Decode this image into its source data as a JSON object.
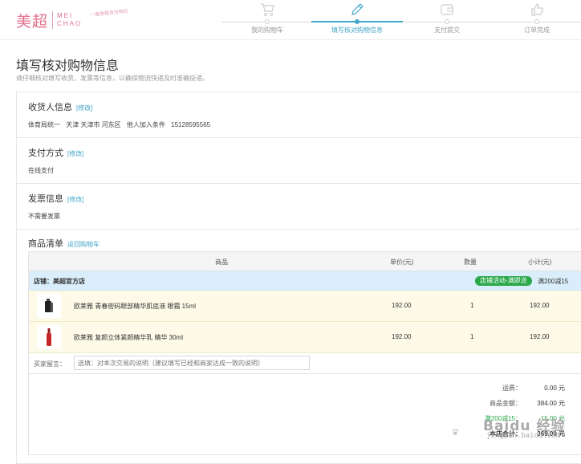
{
  "logo": {
    "cn": "美超",
    "en1": "MEI",
    "en2": "CHAO",
    "slogan": "一直做我身份陶社"
  },
  "steps": [
    {
      "label": "我的购物车",
      "icon": "cart-icon"
    },
    {
      "label": "填写核对购物信息",
      "icon": "pencil-icon",
      "active": true
    },
    {
      "label": "支付提交",
      "icon": "wallet-icon"
    },
    {
      "label": "订单完成",
      "icon": "thumbs-up-icon"
    }
  ],
  "page": {
    "title": "填写核对购物信息",
    "subtitle": "请仔细核对填写收货、发票等信息，以确保物流快递及时准确投递。"
  },
  "recipient": {
    "title": "收货人信息",
    "edit": "[修改]",
    "name": "体育局统一",
    "address": "天津 天津市 河东区",
    "detail": "他人加入条件",
    "phone": "15128595565"
  },
  "payment": {
    "title": "支付方式",
    "edit": "[修改]",
    "value": "在线支付"
  },
  "invoice": {
    "title": "发票信息",
    "edit": "[修改]",
    "value": "不需要发票"
  },
  "goods": {
    "title": "商品清单",
    "back_link": "返回购物车",
    "columns": {
      "product": "商品",
      "price": "单价(元)",
      "qty": "数量",
      "subtotal": "小计(元)"
    },
    "shop": {
      "name": "店铺：美超官方店",
      "badge": "店铺活动-满即送",
      "promo": "满200减15"
    },
    "items": [
      {
        "name": "欧莱雅 青春密码眼部精华肌底液 眼霜 15ml",
        "price": "192.00",
        "qty": "1",
        "subtotal": "192.00"
      },
      {
        "name": "欧莱雅 复颜立体紧颜精华乳 精华 30ml",
        "price": "192.00",
        "qty": "1",
        "subtotal": "192.00"
      }
    ],
    "note": {
      "label": "买家留言：",
      "placeholder": "选填：对本次交易的说明（建议填写已经和商家达成一致的说明）"
    },
    "totals": {
      "shipping_label": "运费：",
      "shipping": "0.00 元",
      "goods_label": "商品金额：",
      "goods": "384.00 元",
      "discount_label": "满200减15：",
      "discount": "-15.00 元",
      "total_label": "本店合计：",
      "total": "369.00 元"
    }
  },
  "watermark": {
    "text": "Baidu 经验",
    "sub": "jingyan.baidu.com"
  },
  "colors": {
    "accent": "#44a6c8",
    "brand": "#e0708c",
    "promo_green": "#2aa84a",
    "shop_bg": "#d9eefa",
    "item_bg": "#fdfbe8"
  }
}
